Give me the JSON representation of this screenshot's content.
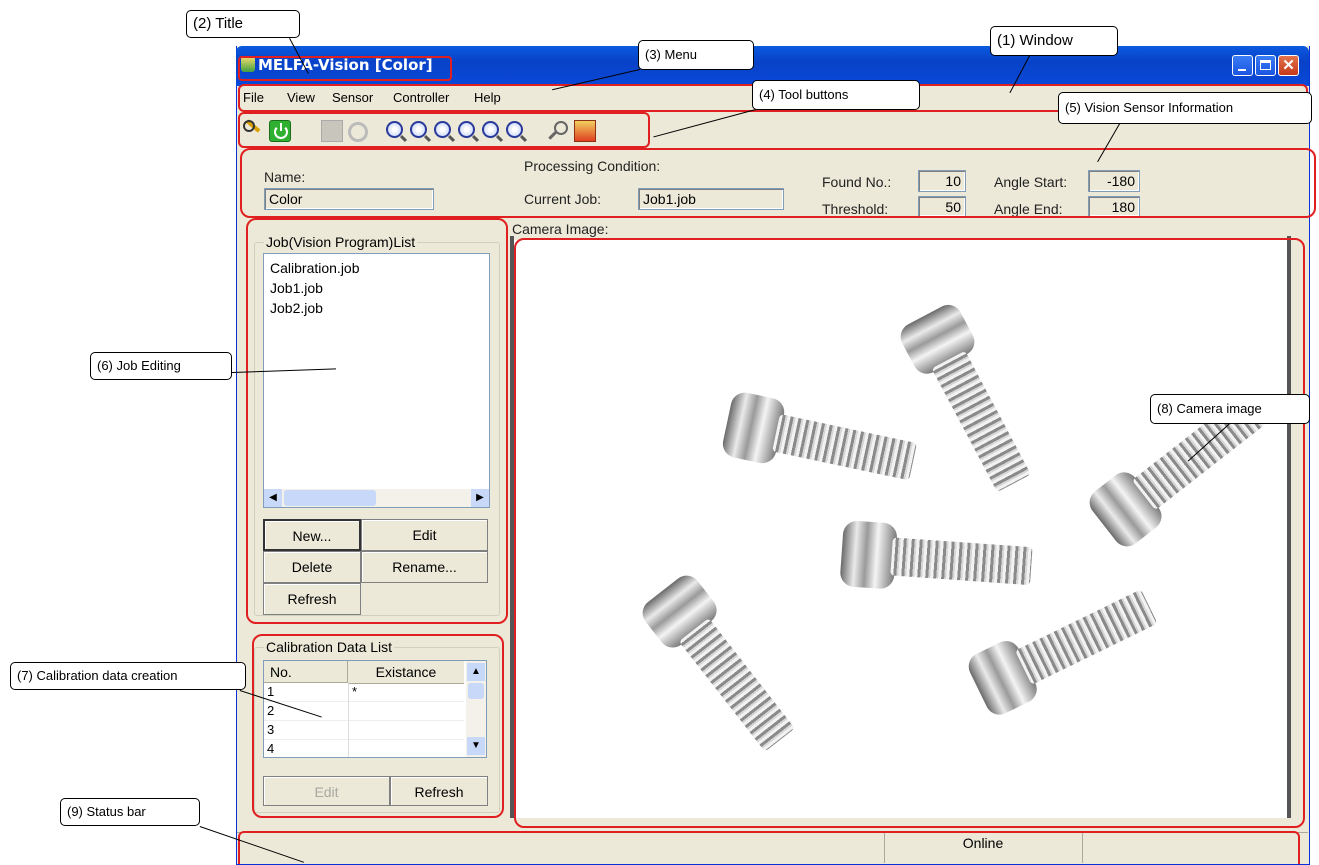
{
  "window": {
    "title": "MELFA-Vision [Color]",
    "menus": [
      "File",
      "View",
      "Sensor",
      "Controller",
      "Help"
    ]
  },
  "toolbar": {
    "icons": [
      "connect-icon",
      "power-icon",
      "image-icon",
      "refresh-icon",
      "zoom-in-icon",
      "zoom-out-icon",
      "zoom-fit-icon",
      "zoom-window-icon",
      "zoom-all-icon",
      "zoom-center-icon",
      "search-icon",
      "export-icon"
    ]
  },
  "sensor_info": {
    "name_label": "Name:",
    "name_value": "Color",
    "processing_label": "Processing Condition:",
    "current_job_label": "Current Job:",
    "current_job_value": "Job1.job",
    "found_no_label": "Found No.:",
    "found_no_value": "10",
    "threshold_label": "Threshold:",
    "threshold_value": "50",
    "angle_start_label": "Angle Start:",
    "angle_start_value": "-180",
    "angle_end_label": "Angle End:",
    "angle_end_value": "180"
  },
  "jobs": {
    "caption": "Job(Vision Program)List",
    "items": [
      "Calibration.job",
      "Job1.job",
      "Job2.job"
    ],
    "buttons": {
      "new": "New...",
      "edit": "Edit",
      "delete": "Delete",
      "rename": "Rename...",
      "refresh": "Refresh"
    }
  },
  "calibration": {
    "caption": "Calibration Data List",
    "columns": [
      "No.",
      "Existance"
    ],
    "rows": [
      [
        "1",
        "*"
      ],
      [
        "2",
        ""
      ],
      [
        "3",
        ""
      ],
      [
        "4",
        ""
      ]
    ],
    "buttons": {
      "edit": "Edit",
      "refresh": "Refresh"
    }
  },
  "camera": {
    "label": "Camera Image:"
  },
  "status": {
    "state": "Online"
  },
  "callouts": {
    "window": "(1) Window",
    "title": "(2) Title",
    "menu": "(3) Menu",
    "tool_buttons": "(4) Tool buttons",
    "sensor_info": "(5) Vision Sensor Information",
    "job_editing": "(6) Job Editing",
    "calibration": "(7) Calibration data creation",
    "camera_image": "(8) Camera image",
    "status_bar": "(9) Status bar"
  },
  "colors": {
    "annotation": "#e02020",
    "titlebar": "#0a5ae0",
    "window_bg": "#ece9d8"
  }
}
